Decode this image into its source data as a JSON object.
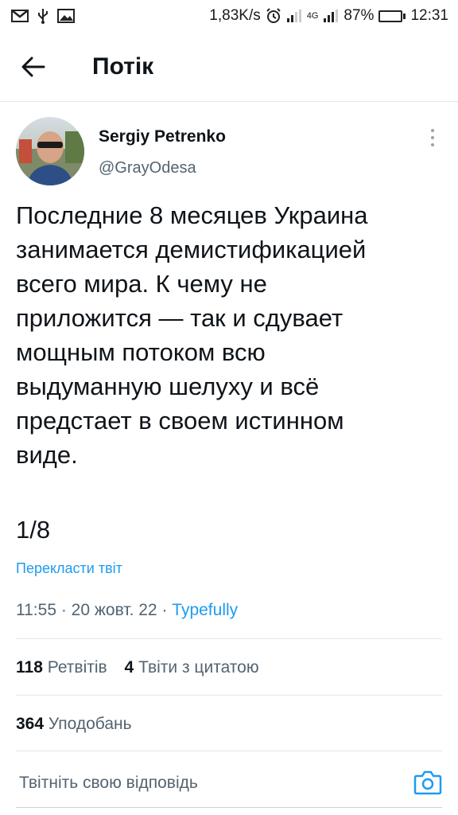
{
  "status_bar": {
    "speed": "1,83K/s",
    "network": "4G",
    "battery": "87%",
    "battery_level": 0.87,
    "time": "12:31",
    "left_icons": [
      "gmail-icon",
      "usb-icon",
      "gallery-icon"
    ]
  },
  "header": {
    "title": "Потік",
    "back_icon": "arrow-left-icon"
  },
  "tweet": {
    "author_name": "Sergiy Petrenko",
    "author_handle": "@GrayOdesa",
    "text": "Последние 8 месяцев Украина\nзанимается демистификацией\nвсего мира. К чему не\nприложится — так и сдувает\nмощным потоком всю\nвыдуманную шелуху и всё\nпредстает в своем истинном\nвиде.",
    "thread_counter": "1/8",
    "translate_label": "Перекласти твіт",
    "time": "11:55",
    "date": "20 жовт. 22",
    "source": "Typefully"
  },
  "stats": {
    "retweets_count": "118",
    "retweets_label": "Ретвітів",
    "quotes_count": "4",
    "quotes_label": "Твіти з цитатою",
    "likes_count": "364",
    "likes_label": "Уподобань"
  },
  "reply": {
    "placeholder": "Твітніть свою відповідь",
    "camera_icon": "camera-icon"
  },
  "colors": {
    "accent": "#1d9bf0",
    "secondary_text": "#536471",
    "battery": "#3fbf3f"
  }
}
